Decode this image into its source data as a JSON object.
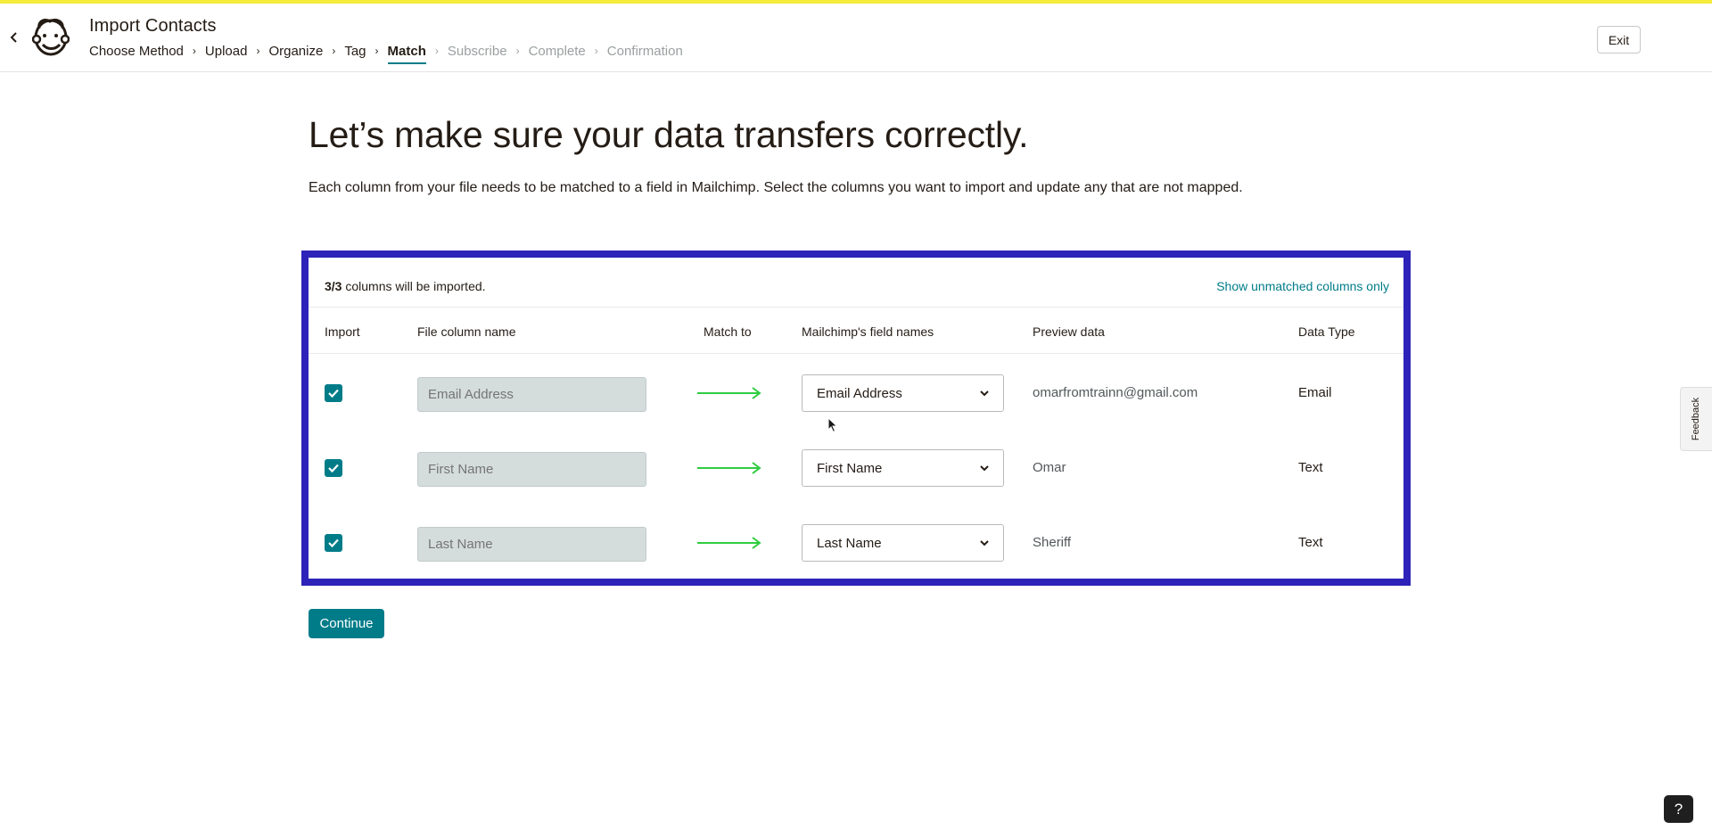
{
  "header": {
    "title": "Import Contacts",
    "exit_label": "Exit",
    "steps": [
      {
        "label": "Choose Method",
        "state": "done"
      },
      {
        "label": "Upload",
        "state": "done"
      },
      {
        "label": "Organize",
        "state": "done"
      },
      {
        "label": "Tag",
        "state": "done"
      },
      {
        "label": "Match",
        "state": "active"
      },
      {
        "label": "Subscribe",
        "state": "disabled"
      },
      {
        "label": "Complete",
        "state": "disabled"
      },
      {
        "label": "Confirmation",
        "state": "disabled"
      }
    ]
  },
  "main": {
    "title": "Let’s make sure your data transfers correctly.",
    "subtitle": "Each column from your file needs to be matched to a field in Mailchimp. Select the columns you want to import and update any that are not mapped."
  },
  "table": {
    "count_bold": "3/3",
    "count_rest": " columns will be imported.",
    "toggle_label": "Show unmatched columns only",
    "headers": {
      "import": "Import",
      "file_column": "File column name",
      "match_to": "Match to",
      "field_names": "Mailchimp's field names",
      "preview": "Preview data",
      "data_type": "Data Type"
    },
    "rows": [
      {
        "checked": true,
        "column_placeholder": "Email Address",
        "field": "Email Address",
        "preview": "omarfromtrainn@gmail.com",
        "type": "Email"
      },
      {
        "checked": true,
        "column_placeholder": "First Name",
        "field": "First Name",
        "preview": "Omar",
        "type": "Text"
      },
      {
        "checked": true,
        "column_placeholder": "Last Name",
        "field": "Last Name",
        "preview": "Sheriff",
        "type": "Text"
      }
    ]
  },
  "actions": {
    "continue_label": "Continue"
  },
  "widgets": {
    "feedback_label": "Feedback",
    "help_label": "?"
  },
  "colors": {
    "accent": "#007c89",
    "top_bar": "#f5ec3b",
    "highlight_border": "#2d23b8",
    "arrow": "#2ecc40"
  }
}
